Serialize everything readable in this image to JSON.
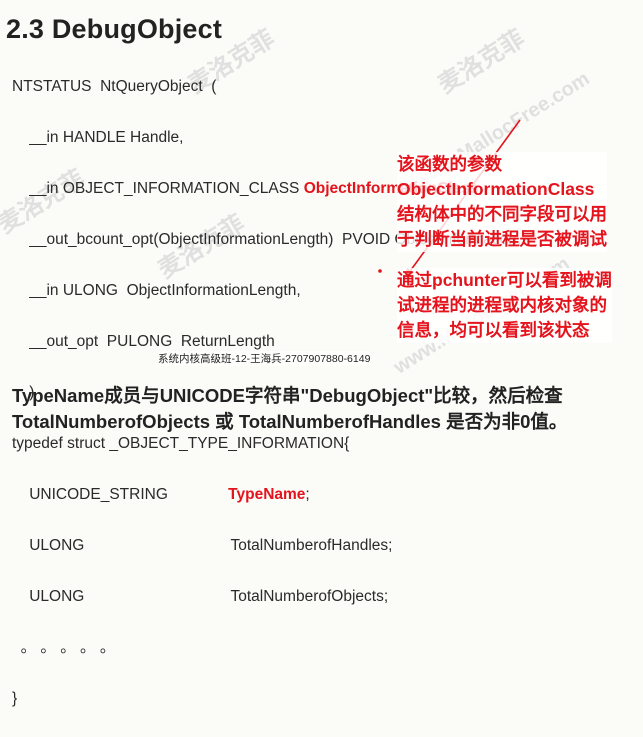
{
  "slide": {
    "title": "2.3 DebugObject",
    "code_lines": [
      "NTSTATUS  NtQueryObject  (",
      "    __in HANDLE Handle,",
      "    __in OBJECT_INFORMATION_CLASS ",
      "    __out_bcount_opt(ObjectInformationLength)  PVOID ObjectInformation,",
      "    __in ULONG  ObjectInformationLength,",
      "    __out_opt  PULONG  ReturnLength",
      "    )",
      "typedef struct _OBJECT_TYPE_INFORMATION{",
      "    UNICODE_STRING              ",
      "    ULONG                                  TotalNumberofHandles;",
      "    ULONG                                  TotalNumberofObjects;",
      "  。 。 。 。 。",
      "}"
    ],
    "code_red_1": "ObjectInformationClass",
    "code_red_1_suffix": ",",
    "code_red_2": "TypeName",
    "code_red_2_suffix": ";",
    "note1_lines": [
      "该函数的参数",
      "ObjectInformationClass",
      "结构体中的不同字段可以用",
      "于判断当前进程是否被调试"
    ],
    "note2_lines": [
      "通过pchunter可以看到被调",
      "试进程的进程或内核对象的",
      "信息，均可以看到该状态"
    ],
    "caption": "系统内核高级班-12-王海兵-2707907880-6149",
    "bottom_line1": "TypeName成员与UNICODE字符串\"DebugObject\"比较，然后检查",
    "bottom_line2": "TotalNumberofObjects 或 TotalNumberofHandles 是否为非0值。",
    "watermark": "麦洛克菲",
    "watermark2": "www.MallocFree.com"
  },
  "colors": {
    "accent_red": "#e4131c",
    "text": "#222222",
    "background": "#fbfbf8"
  }
}
